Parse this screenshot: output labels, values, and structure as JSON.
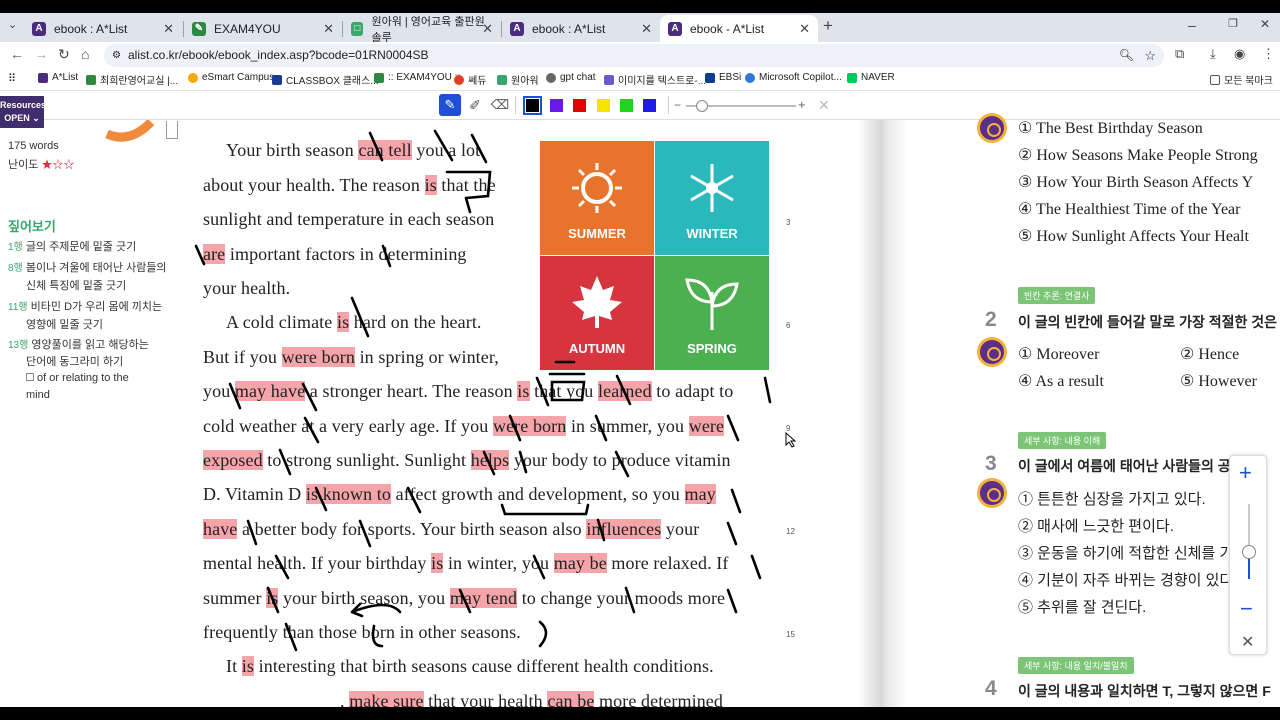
{
  "browser": {
    "tabs": [
      {
        "title": "ebook : A*List"
      },
      {
        "title": "EXAM4YOU"
      },
      {
        "title": "원아워 | 영어교육 출판원 솔루"
      },
      {
        "title": "ebook : A*List"
      },
      {
        "title": "ebook - A*List"
      }
    ],
    "new_tab": "+",
    "url": "alist.co.kr/ebook/ebook_index.asp?bcode=01RN0004SB",
    "bookmarks": [
      "A*List",
      "최희란영어교실 |...",
      "eSmart Campus",
      "CLASSBOX 클래스...",
      ":: EXAM4YOU ::",
      "쎄듀",
      "원아워",
      "gpt chat",
      "이미지를 텍스트로-...",
      "EBSi",
      "Microsoft Copilot...",
      "NAVER"
    ],
    "bookmarks_folder": "모든 북마크"
  },
  "toolbar": {
    "resources": "Resources",
    "open": "OPEN",
    "colors": [
      "#000000",
      "#6a18e8",
      "#e60000",
      "#f5e400",
      "#22d322",
      "#1e1ee8"
    ],
    "minus": "−",
    "plus": "+"
  },
  "left": {
    "words": "175 words",
    "level_label": "난이도",
    "stars": "★☆☆",
    "section_title": "짚어보기",
    "notes": [
      {
        "num": "1행",
        "text": "글의 주제문에 밑줄 긋기"
      },
      {
        "num": "8행",
        "text": "봄이나 겨울에 태어난 사람들의",
        "text2": "신체 특징에 밑줄 긋기"
      },
      {
        "num": "11행",
        "text": "비타민 D가 우리 몸에 끼치는",
        "text2": "영향에 밑줄 긋기"
      },
      {
        "num": "13행",
        "text": "영양풀이를 읽고 해당하는",
        "text2": "단어에 동그라미 하기"
      }
    ],
    "gloss": "of or relating to the",
    "gloss2": "mind"
  },
  "passage": {
    "line_nums": [
      "3",
      "6",
      "9",
      "12",
      "15"
    ],
    "seasons": [
      "SUMMER",
      "WINTER",
      "AUTUMN",
      "SPRING"
    ],
    "season_colors": [
      "#e8732c",
      "#2bb8bd",
      "#d6343f",
      "#4caf50"
    ]
  },
  "right": {
    "q1_options": [
      "① The Best Birthday Season",
      "② How Seasons Make People Strong",
      "③ How Your Birth Season Affects Y",
      "④ The Healthiest Time of the Year",
      "⑤ How Sunlight Affects Your Healt"
    ],
    "q2_label": "빈칸 추론: 연결사",
    "q2_num": "2",
    "q2_title": "이 글의 빈칸에 들어갈 말로 가장 적절한 것은",
    "q2_options": [
      "① Moreover",
      "② Hence",
      "④ As a result",
      "⑤ However"
    ],
    "q3_label": "세부 사항: 내용 이해",
    "q3_num": "3",
    "q3_title": "이 글에서 여름에 태어난 사람들의 공",
    "q3_options": [
      "① 튼튼한 심장을 가지고 있다.",
      "② 매사에 느긋한 편이다.",
      "③ 운동을 하기에 적합한 신체를 가",
      "④ 기분이 자주 바뀌는 경향이 있다",
      "⑤ 추위를 잘 견딘다."
    ],
    "q4_label": "세부 사항: 내용 일치/불일치",
    "q4_num": "4",
    "q4_title": "이 글의 내용과 일치하면 T, 그렇지 않으면 F"
  },
  "zoom": {
    "plus": "+",
    "minus": "−",
    "close": "✕"
  }
}
